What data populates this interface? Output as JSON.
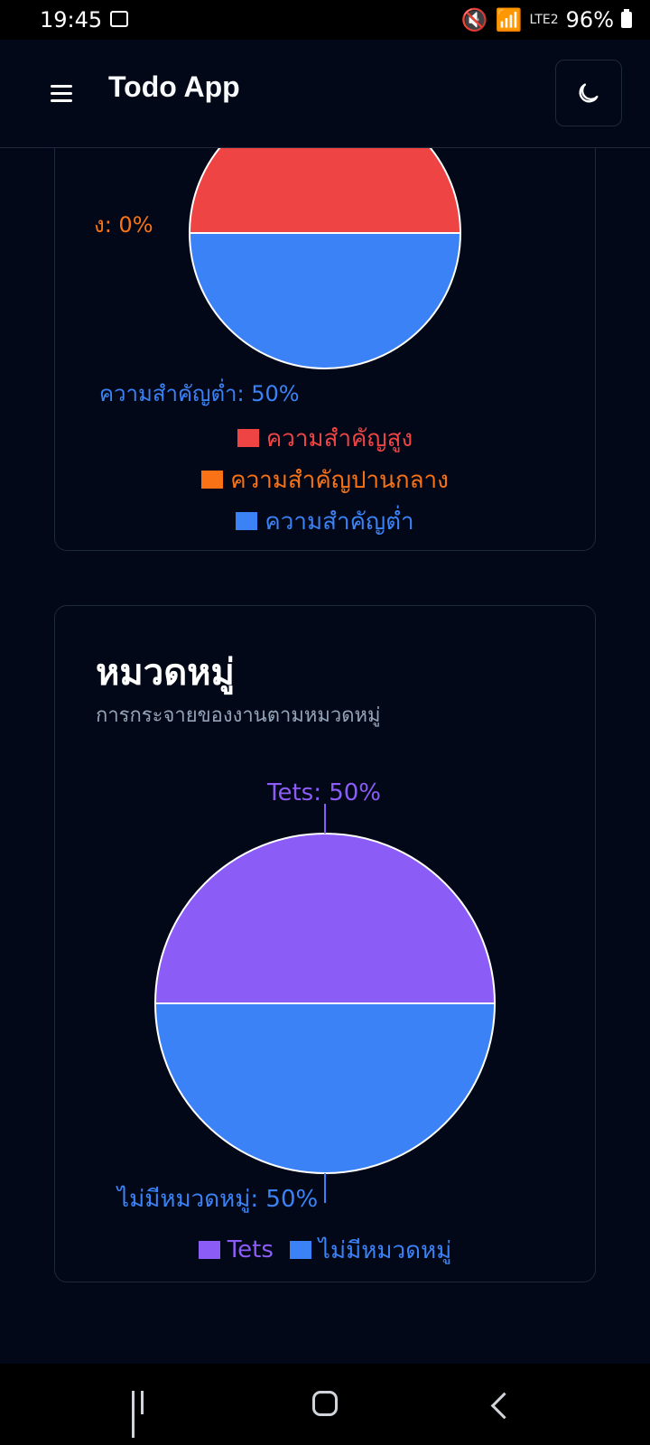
{
  "status_bar": {
    "time": "19:45",
    "network": "LTE2",
    "battery": "96%"
  },
  "header": {
    "title": "Todo App"
  },
  "priority_card": {
    "labels": {
      "medium": "ง: 0%",
      "low": "ความสำคัญต่ำ: 50%"
    },
    "legend": [
      "ความสำคัญสูง",
      "ความสำคัญปานกลาง",
      "ความสำคัญต่ำ"
    ],
    "colors": [
      "#ef4444",
      "#f97316",
      "#3b82f6"
    ]
  },
  "category_card": {
    "title": "หมวดหมู่",
    "subtitle": "การกระจายของงานตามหมวดหมู่",
    "labels": {
      "tets": "Tets: 50%",
      "none": "ไม่มีหมวดหมู่: 50%"
    },
    "legend": [
      "Tets",
      "ไม่มีหมวดหมู่"
    ],
    "colors": [
      "#8b5cf6",
      "#3b82f6"
    ]
  },
  "chart_data": [
    {
      "type": "pie",
      "categories": [
        "ความสำคัญสูง",
        "ความสำคัญปานกลาง",
        "ความสำคัญต่ำ"
      ],
      "values": [
        50,
        0,
        50
      ],
      "colors": [
        "#ef4444",
        "#f97316",
        "#3b82f6"
      ]
    },
    {
      "type": "pie",
      "title": "หมวดหมู่",
      "subtitle": "การกระจายของงานตามหมวดหมู่",
      "categories": [
        "Tets",
        "ไม่มีหมวดหมู่"
      ],
      "values": [
        50,
        50
      ],
      "colors": [
        "#8b5cf6",
        "#3b82f6"
      ]
    }
  ],
  "icons": {
    "menu": "menu-icon",
    "theme": "moon-icon",
    "gallery": "gallery-icon",
    "recent": "recent-apps-icon",
    "home": "home-icon",
    "back": "back-icon"
  }
}
